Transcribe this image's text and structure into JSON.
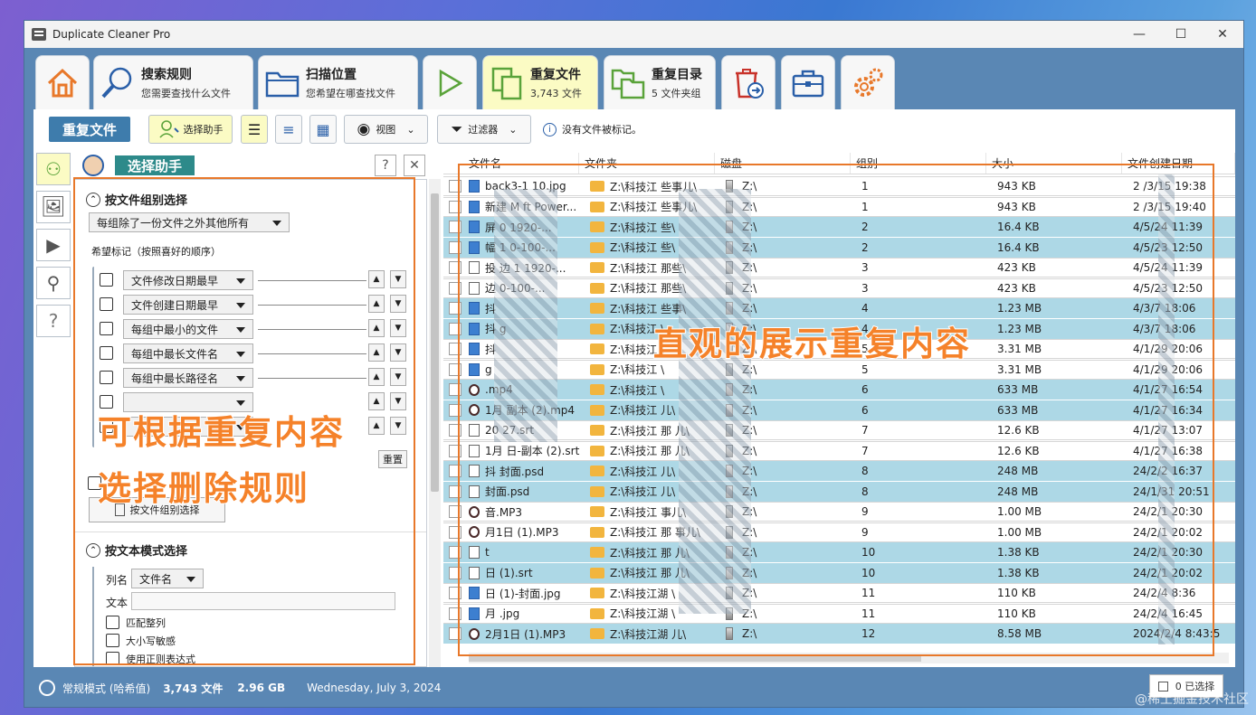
{
  "window": {
    "title": "Duplicate Cleaner Pro",
    "min": "—",
    "max": "☐",
    "close": "✕"
  },
  "tabs": [
    {
      "title": "",
      "sub": ""
    },
    {
      "title": "搜索规则",
      "sub": "您需要查找什么文件"
    },
    {
      "title": "扫描位置",
      "sub": "您希望在哪查找文件"
    },
    {
      "title": "",
      "sub": ""
    },
    {
      "title": "重复文件",
      "sub": "3,743 文件"
    },
    {
      "title": "重复目录",
      "sub": "5 文件夹组"
    }
  ],
  "toolbar": {
    "main_label": "重复文件",
    "helper_label": "选择助手",
    "view_label": "视图",
    "filter_label": "过滤器",
    "status_text": "没有文件被标记。"
  },
  "panel": {
    "header": "选择助手",
    "help": "?",
    "close": "✕",
    "group_section": "按文件组别选择",
    "group_mode": "每组除了一份文件之外其他所有",
    "pref_label": "希望标记（按照喜好的顺序）",
    "rules": [
      "文件修改日期最早",
      "文件创建日期最早",
      "每组中最小的文件",
      "每组中最长文件名",
      "每组中最长路径名"
    ],
    "reset": "重置",
    "apply_group": "按文件组别选择",
    "text_section": "按文本模式选择",
    "col_label": "列名",
    "col_value": "文件名",
    "text_label": "文本",
    "opt_whole": "匹配整列",
    "opt_case": "大小写敏感",
    "opt_regex": "使用正则表达式"
  },
  "grid": {
    "headers": [
      "文件名",
      "文件夹",
      "磁盘",
      "组别",
      "大小",
      "文件创建日期"
    ],
    "rows": [
      {
        "name": "back3-1  10.jpg",
        "folder": "Z:\\科技江  些事儿\\",
        "disk": "Z:\\",
        "group": "1",
        "size": "943 KB",
        "date": "2  /3/15 19:38",
        "type": "img",
        "hl": false
      },
      {
        "name": "新建 M  ft Power...",
        "folder": "Z:\\科技江  些事儿\\",
        "disk": "Z:\\",
        "group": "1",
        "size": "943 KB",
        "date": "2  /3/15 19:40",
        "type": "img",
        "hl": false
      },
      {
        "name": "  屏  0  1920-...",
        "folder": "Z:\\科技江  些\\",
        "disk": "Z:\\",
        "group": "2",
        "size": "16.4 KB",
        "date": "  4/5/24 11:39",
        "type": "img",
        "hl": true
      },
      {
        "name": "  幅  1  0-100-...",
        "folder": "Z:\\科技江  些\\",
        "disk": "Z:\\",
        "group": "2",
        "size": "16.4 KB",
        "date": "  4/5/23 12:50",
        "type": "img",
        "hl": true
      },
      {
        "name": "投  边  1  1920-...",
        "folder": "Z:\\科技江  那些\\",
        "disk": "Z:\\",
        "group": "3",
        "size": "423 KB",
        "date": "  4/5/24 11:39",
        "type": "doc",
        "hl": false
      },
      {
        "name": "边  0-100-...",
        "folder": "Z:\\科技江  那些\\",
        "disk": "Z:\\",
        "group": "3",
        "size": "423 KB",
        "date": "  4/5/23 12:50",
        "type": "doc",
        "hl": false
      },
      {
        "name": "抖  ",
        "folder": "Z:\\科技江  些事\\",
        "disk": "Z:\\",
        "group": "4",
        "size": "1.23 MB",
        "date": "  4/3/7 18:06",
        "type": "img",
        "hl": true
      },
      {
        "name": "抖  g",
        "folder": "Z:\\科技江  \\",
        "disk": "Z:\\",
        "group": "4",
        "size": "1.23 MB",
        "date": "  4/3/7 18:06",
        "type": "img",
        "hl": true
      },
      {
        "name": "抖  ",
        "folder": "Z:\\科技江  \\",
        "disk": "Z:\\",
        "group": "5",
        "size": "3.31 MB",
        "date": "  4/1/29 20:06",
        "type": "img",
        "hl": false
      },
      {
        "name": "  g",
        "folder": "Z:\\科技江  \\",
        "disk": "Z:\\",
        "group": "5",
        "size": "3.31 MB",
        "date": "  4/1/29 20:06",
        "type": "img",
        "hl": false
      },
      {
        "name": "  .mp4",
        "folder": "Z:\\科技江  \\",
        "disk": "Z:\\",
        "group": "6",
        "size": "633 MB",
        "date": "  4/1/27 16:54",
        "type": "vid",
        "hl": true
      },
      {
        "name": "1月  副本 (2).mp4",
        "folder": "Z:\\科技江  儿\\",
        "disk": "Z:\\",
        "group": "6",
        "size": "633 MB",
        "date": "  4/1/27 16:34",
        "type": "vid",
        "hl": true
      },
      {
        "name": "20  27.srt",
        "folder": "Z:\\科技江  那  儿\\",
        "disk": "Z:\\",
        "group": "7",
        "size": "12.6 KB",
        "date": "  4/1/27 13:07",
        "type": "doc",
        "hl": false
      },
      {
        "name": "1月  日-副本 (2).srt",
        "folder": "Z:\\科技江  那  儿\\",
        "disk": "Z:\\",
        "group": "7",
        "size": "12.6 KB",
        "date": "  4/1/27 16:38",
        "type": "doc",
        "hl": false
      },
      {
        "name": "抖  封面.psd",
        "folder": "Z:\\科技江  儿\\",
        "disk": "Z:\\",
        "group": "8",
        "size": "248 MB",
        "date": "  24/2/2 16:37",
        "type": "doc",
        "hl": true
      },
      {
        "name": "  封面.psd",
        "folder": "Z:\\科技江  儿\\",
        "disk": "Z:\\",
        "group": "8",
        "size": "248 MB",
        "date": "  24/1/31 20:51",
        "type": "doc",
        "hl": true
      },
      {
        "name": "  音.MP3",
        "folder": "Z:\\科技江  事儿\\",
        "disk": "Z:\\",
        "group": "9",
        "size": "1.00 MB",
        "date": "  24/2/1 20:30",
        "type": "vid",
        "hl": false
      },
      {
        "name": "  月1日 (1).MP3",
        "folder": "Z:\\科技江  那  事儿\\",
        "disk": "Z:\\",
        "group": "9",
        "size": "1.00 MB",
        "date": "  24/2/1 20:02",
        "type": "vid",
        "hl": false
      },
      {
        "name": "  t",
        "folder": "Z:\\科技江  那  儿\\",
        "disk": "Z:\\",
        "group": "10",
        "size": "1.38 KB",
        "date": "  24/2/1 20:30",
        "type": "doc",
        "hl": true
      },
      {
        "name": "  日 (1).srt",
        "folder": "Z:\\科技江  那  儿\\",
        "disk": "Z:\\",
        "group": "10",
        "size": "1.38 KB",
        "date": "  24/2/1 20:02",
        "type": "doc",
        "hl": true
      },
      {
        "name": "  日 (1)-封面.jpg",
        "folder": "Z:\\科技江湖  \\",
        "disk": "Z:\\",
        "group": "11",
        "size": "110 KB",
        "date": "  24/2/4 8:36",
        "type": "img",
        "hl": false
      },
      {
        "name": "  月  .jpg",
        "folder": "Z:\\科技江湖  \\",
        "disk": "Z:\\",
        "group": "11",
        "size": "110 KB",
        "date": "  24/2/4 16:45",
        "type": "img",
        "hl": false
      },
      {
        "name": "2月1日 (1).MP3",
        "folder": "Z:\\科技江湖  儿\\",
        "disk": "Z:\\",
        "group": "12",
        "size": "8.58 MB",
        "date": "2024/2/4 8:43:5",
        "type": "vid",
        "hl": true
      }
    ]
  },
  "status": {
    "mode": "常规模式 (哈希值)",
    "files": "3,743 文件",
    "size": "2.96 GB",
    "date": "Wednesday, July 3, 2024",
    "selected": "0 已选择"
  },
  "annotations": {
    "left_line1": "可根据重复内容",
    "left_line2": "选择删除规则",
    "right": "直观的展示重复内容"
  },
  "watermark": "@稀土掘金技术社区",
  "colors": {
    "accent": "#3e7cac",
    "highlight_row": "#add8e6",
    "active_tab": "#fbfbc4",
    "annotation": "#f5822a"
  }
}
